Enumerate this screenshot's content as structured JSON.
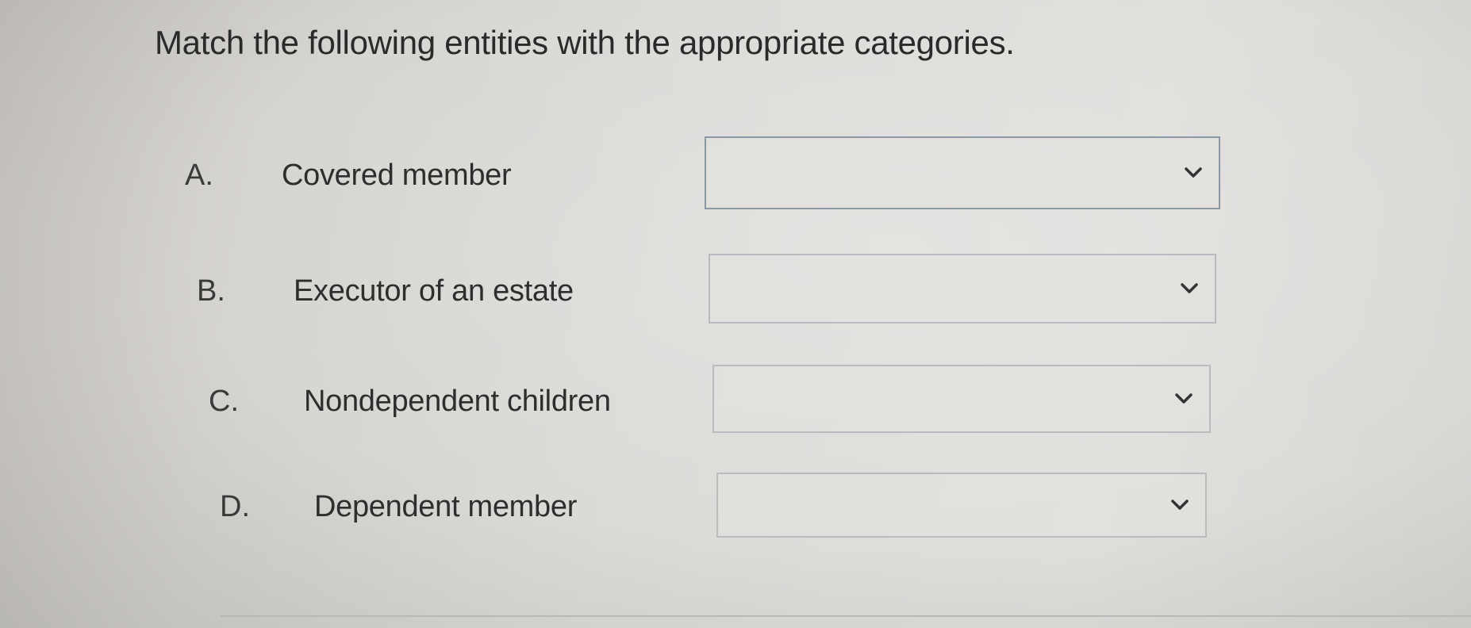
{
  "question": {
    "title": "Match the following entities with the appropriate categories."
  },
  "rows": [
    {
      "letter": "A.",
      "label": "Covered member",
      "selected": ""
    },
    {
      "letter": "B.",
      "label": "Executor of an estate",
      "selected": ""
    },
    {
      "letter": "C.",
      "label": "Nondependent children",
      "selected": ""
    },
    {
      "letter": "D.",
      "label": "Dependent member",
      "selected": ""
    }
  ],
  "icons": {
    "dropdown": "chevron-down-icon"
  }
}
